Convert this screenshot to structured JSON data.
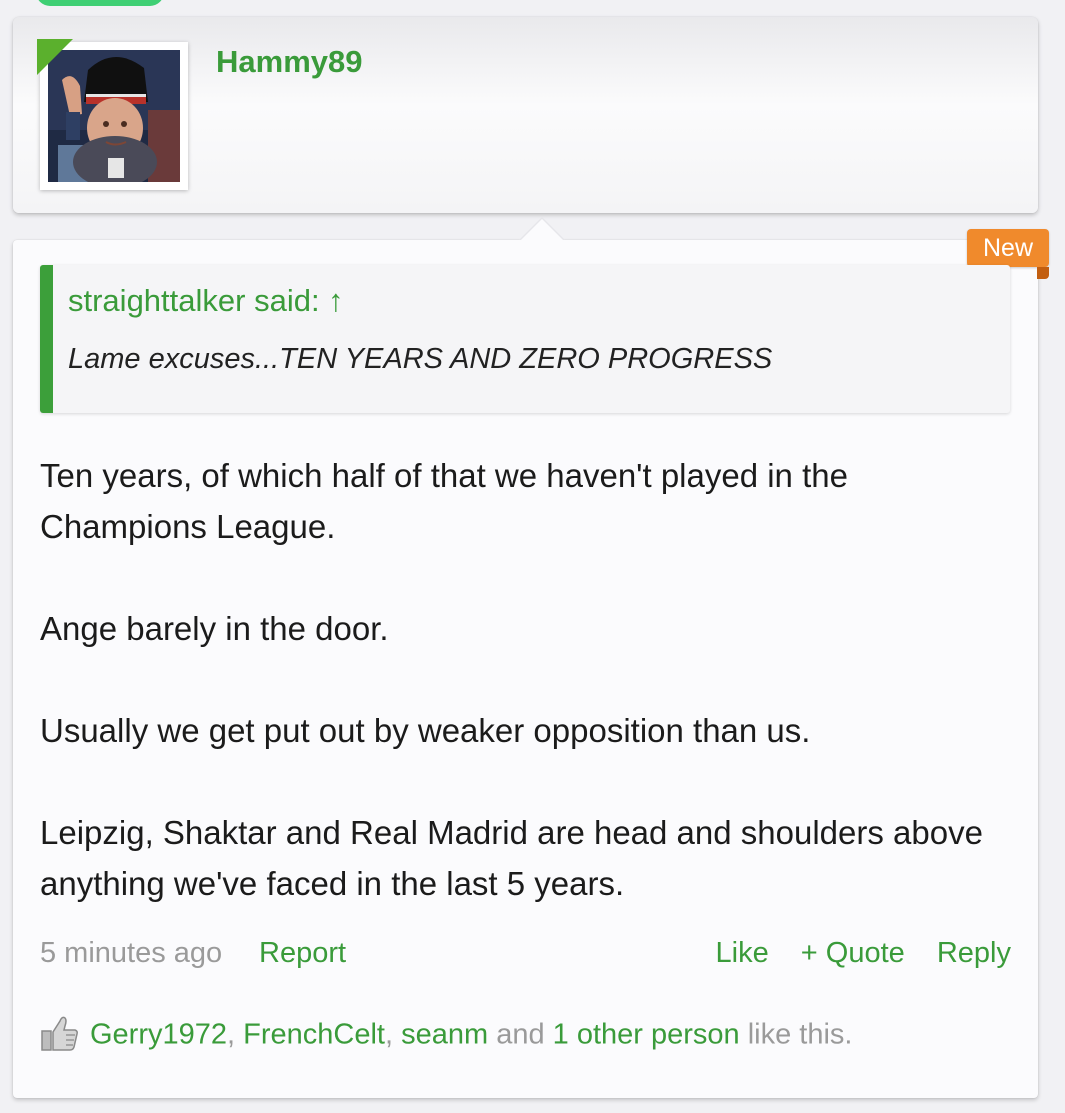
{
  "profile": {
    "username": "Hammy89",
    "avatar_icon": "avatar-photo"
  },
  "post": {
    "badge": "New",
    "quote": {
      "author": "straighttalker said: ↑",
      "text": "Lame excuses...TEN YEARS AND ZERO PROGRESS"
    },
    "paragraphs": [
      "Ten years, of which half of that we haven't played in the Champions League.",
      "Ange barely in the door.",
      "Usually we get put out by weaker opposition than us.",
      "Leipzig, Shaktar and Real Madrid are head and shoulders above anything we've faced in the last 5 years."
    ],
    "time": "5 minutes ago",
    "report_label": "Report",
    "like_label": "Like",
    "quote_label": "+ Quote",
    "reply_label": "Reply",
    "likes": {
      "icon": "thumbs-up-icon",
      "user1": "Gerry1972",
      "sep1": ", ",
      "user2": "FrenchCelt",
      "sep2": ", ",
      "user3": "seanm",
      "and": " and ",
      "others": "1 other person",
      "suffix": " like this."
    }
  },
  "colors": {
    "accent_green": "#3a9b3a",
    "badge_orange": "#f08a2c",
    "muted_text": "#9a9a9a"
  }
}
